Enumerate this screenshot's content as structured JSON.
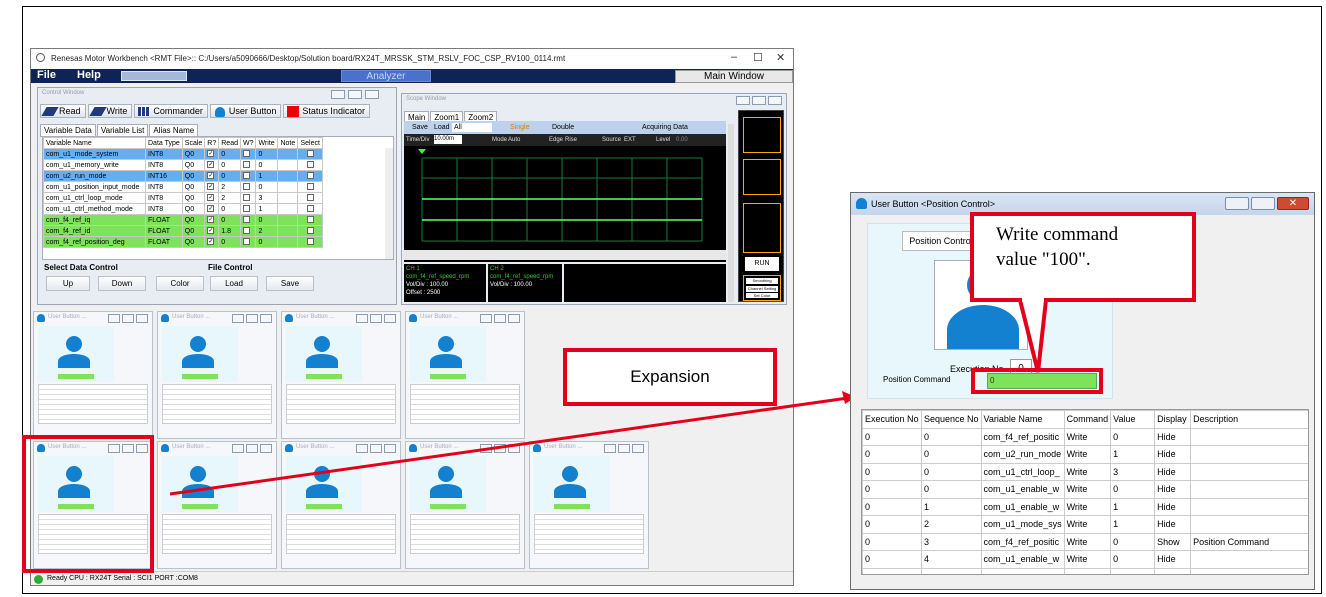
{
  "workbench": {
    "title": "Renesas Motor Workbench   <RMT File>:: C:/Users/a5090666/Desktop/Solution board/RX24T_MRSSK_STM_RSLV_FOC_CSP_RV100_0114.rmt",
    "menu": {
      "file": "File",
      "help": "Help"
    },
    "analyzer_label": "Analyzer",
    "main_window_label": "Main Window",
    "status": "Ready  CPU : RX24T Serial : SCI1  PORT :COM8"
  },
  "control_window": {
    "title": "Control Window",
    "toolbar": {
      "read": "Read",
      "write": "Write",
      "commander": "Commander",
      "user_button": "User Button",
      "status_indicator": "Status Indicator"
    },
    "tabs": [
      "Variable Data",
      "Variable List",
      "Alias Name"
    ],
    "columns": [
      "Variable Name",
      "Data Type",
      "Scale",
      "R?",
      "Read",
      "W?",
      "Write",
      "Note",
      "Select"
    ],
    "rows": [
      {
        "name": "com_u1_mode_system",
        "type": "INT8",
        "scale": "Q0",
        "read": "0",
        "write": "0"
      },
      {
        "name": "com_u1_memory_write",
        "type": "INT8",
        "scale": "Q0",
        "read": "0",
        "write": "0"
      },
      {
        "name": "com_u2_run_mode",
        "type": "INT16",
        "scale": "Q0",
        "read": "0",
        "write": "1"
      },
      {
        "name": "com_u1_position_input_mode",
        "type": "INT8",
        "scale": "Q0",
        "read": "2",
        "write": "0"
      },
      {
        "name": "com_u1_ctrl_loop_mode",
        "type": "INT8",
        "scale": "Q0",
        "read": "2",
        "write": "3"
      },
      {
        "name": "com_u1_ctrl_method_mode",
        "type": "INT8",
        "scale": "Q0",
        "read": "0",
        "write": "1"
      },
      {
        "name": "com_f4_ref_iq",
        "type": "FLOAT",
        "scale": "Q0",
        "read": "0",
        "write": "0"
      },
      {
        "name": "com_f4_ref_id",
        "type": "FLOAT",
        "scale": "Q0",
        "read": "1.8",
        "write": "2"
      },
      {
        "name": "com_f4_ref_position_deg",
        "type": "FLOAT",
        "scale": "Q0",
        "read": "0",
        "write": "0"
      }
    ],
    "select_data_control": {
      "label": "Select Data Control",
      "up": "Up",
      "down": "Down",
      "color": "Color"
    },
    "file_control": {
      "label": "File Control",
      "load": "Load",
      "save": "Save"
    }
  },
  "scope_window": {
    "title": "Scope Window",
    "tabs": [
      "Main",
      "Zoom1",
      "Zoom2"
    ],
    "toolbar": {
      "save": "Save",
      "load": "Load",
      "all": "All",
      "single": "Single",
      "double": "Double",
      "acquiring": "Acquiring Data"
    },
    "settings": {
      "time_div_label": "Time/Div",
      "time_div": "10.00m",
      "mode_label": "Mode",
      "mode": "Auto",
      "edge_label": "Edge",
      "edge": "Rise",
      "source_label": "Source",
      "source": "EXT",
      "level_label": "Level",
      "level": "0.00"
    },
    "ch1": {
      "line1": "CH 1",
      "line2": "com_f4_ref_speed_rpm",
      "line3": "Vol/Div : 100.00",
      "line4": "Offset : 2500"
    },
    "ch2": {
      "line1": "CH 2",
      "line2": "com_f4_ref_speed_rpm",
      "line3": "Vol/Div : 100.00"
    },
    "run": "RUN",
    "side": {
      "smoothing": "Smoothing",
      "channel_setting": "Channel Setting",
      "set_color": "Set Color"
    }
  },
  "tiles": [
    {
      "title": "User Button ..."
    },
    {
      "title": "User Button ..."
    },
    {
      "title": "User Button ..."
    },
    {
      "title": "User Button ..."
    },
    {
      "title": "User Button ..."
    },
    {
      "title": "User Button ..."
    },
    {
      "title": "User Button ..."
    },
    {
      "title": "User Button ..."
    },
    {
      "title": "User Button ..."
    }
  ],
  "user_button": {
    "title": "User Button <Position Control>",
    "position_control_label": "Position Control",
    "execution_no_label": "Execution No.",
    "execution_no_value": "0",
    "position_command_label": "Position Command",
    "position_command_value": "0",
    "columns": [
      "Execution No",
      "Sequence No",
      "Variable Name",
      "Command",
      "Value",
      "Display",
      "Description"
    ],
    "rows": [
      {
        "exec": "0",
        "seq": "0",
        "var": "com_f4_ref_positic",
        "cmd": "Write",
        "val": "0",
        "disp": "Hide",
        "desc": ""
      },
      {
        "exec": "0",
        "seq": "0",
        "var": "com_u2_run_mode",
        "cmd": "Write",
        "val": "1",
        "disp": "Hide",
        "desc": ""
      },
      {
        "exec": "0",
        "seq": "0",
        "var": "com_u1_ctrl_loop_",
        "cmd": "Write",
        "val": "3",
        "disp": "Hide",
        "desc": ""
      },
      {
        "exec": "0",
        "seq": "0",
        "var": "com_u1_enable_w",
        "cmd": "Write",
        "val": "0",
        "disp": "Hide",
        "desc": ""
      },
      {
        "exec": "0",
        "seq": "1",
        "var": "com_u1_enable_w",
        "cmd": "Write",
        "val": "1",
        "disp": "Hide",
        "desc": ""
      },
      {
        "exec": "0",
        "seq": "2",
        "var": "com_u1_mode_sys",
        "cmd": "Write",
        "val": "1",
        "disp": "Hide",
        "desc": ""
      },
      {
        "exec": "0",
        "seq": "3",
        "var": "com_f4_ref_positic",
        "cmd": "Write",
        "val": "0",
        "disp": "Show",
        "desc": "Position Command"
      },
      {
        "exec": "0",
        "seq": "4",
        "var": "com_u1_enable_w",
        "cmd": "Write",
        "val": "0",
        "disp": "Hide",
        "desc": ""
      }
    ]
  },
  "annotations": {
    "expansion": "Expansion",
    "write_command_line1": "Write command",
    "write_command_line2": "value \"100\"."
  },
  "colors": {
    "highlight_blue": "#66aef2",
    "highlight_green": "#7ee35a",
    "accent_red": "#e3001b",
    "menubar": "#0f2456",
    "avatar": "#1380d0"
  }
}
